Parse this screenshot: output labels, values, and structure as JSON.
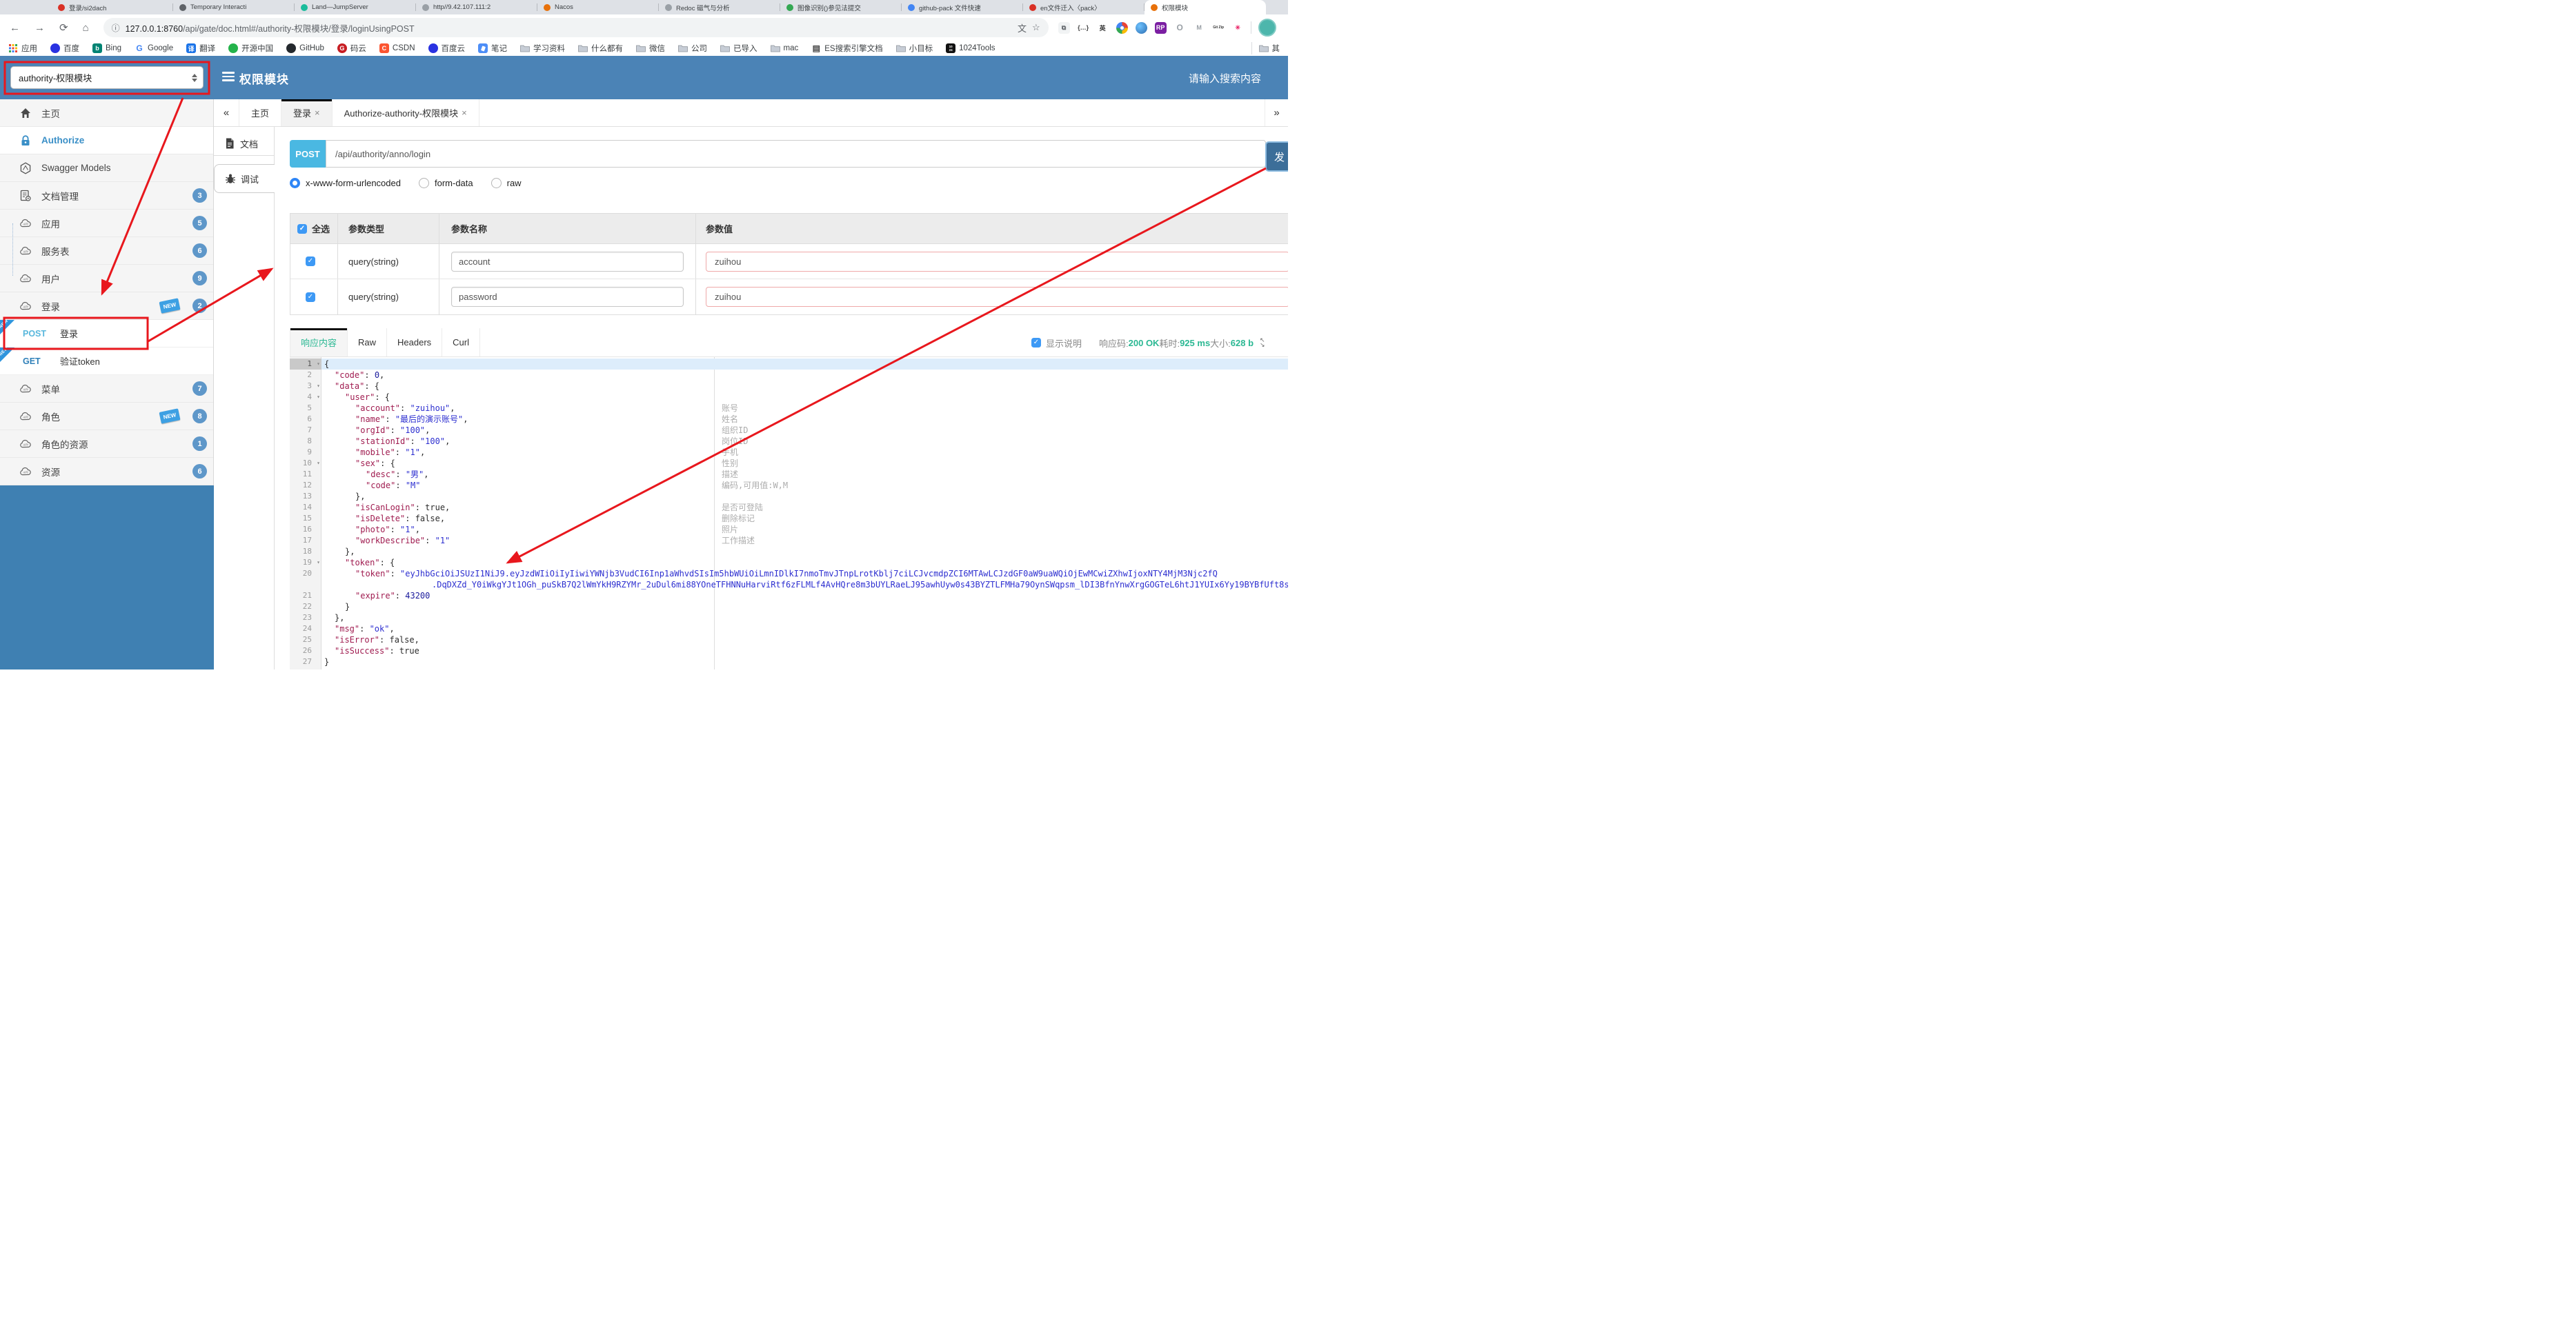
{
  "annotation_color": "#e8171d",
  "browser": {
    "tab_strip": [
      {
        "title": "登录/si2dach",
        "icon_color": "#d93025"
      },
      {
        "title": "Temporary Interacti",
        "icon_color": "#5f6368"
      },
      {
        "title": "Land—JumpServer",
        "icon_color": "#1abc9c"
      },
      {
        "title": "http//9.42.107.111:2",
        "icon_color": "#9aa0a6"
      },
      {
        "title": "Nacos",
        "icon_color": "#e8710a"
      },
      {
        "title": "Redoc 磁气与分析",
        "icon_color": "#9aa0a6"
      },
      {
        "title": "图像识别()参见法提交",
        "icon_color": "#34a853"
      },
      {
        "title": "github-pack 文件快速",
        "icon_color": "#4285f4"
      },
      {
        "title": "en文件迁入〈pack〉",
        "icon_color": "#d93025"
      },
      {
        "title": "权限模块",
        "icon_color": "#e8710a",
        "active": true
      }
    ],
    "toolbar": {
      "url_host": "127.0.0.1:8760",
      "url_path": "/api/gate/doc.html#/authority-权限模块/登录/loginUsingPOST",
      "info_icon": "ⓘ",
      "translate_icon": "文",
      "star_icon": "☆",
      "extensions": [
        {
          "name": "page-icon",
          "glyph": "⧉",
          "fg": "#5f6368",
          "bg": "#f1f3f4"
        },
        {
          "name": "braces-icon",
          "glyph": "{…}",
          "fg": "#444",
          "bg": "#fff"
        },
        {
          "name": "en-translate-icon",
          "glyph": "英",
          "fg": "#333",
          "bg": "#fff"
        },
        {
          "name": "chrome-icon",
          "glyph": "",
          "fg": "#fff",
          "bg": "conic"
        },
        {
          "name": "globe-icon",
          "glyph": "",
          "fg": "#fff",
          "bg": "#3a7bd5"
        },
        {
          "name": "rp-icon",
          "glyph": "RP",
          "fg": "#fff",
          "bg": "#7b1fa2"
        },
        {
          "name": "ring-icon",
          "glyph": "O",
          "fg": "#9aa0a6",
          "bg": "#fff"
        },
        {
          "name": "chevron-icon",
          "glyph": "M",
          "fg": "#9aa0a6",
          "bg": "#fff"
        },
        {
          "name": "gitzip-icon",
          "glyph": "Git Zip",
          "fg": "#333",
          "bg": "#fff"
        },
        {
          "name": "asterisk-icon",
          "glyph": "✳",
          "fg": "#e91e63",
          "bg": "#fff"
        }
      ]
    },
    "bookmarks": [
      {
        "label": "应用",
        "icon": "apps"
      },
      {
        "label": "百度",
        "icon": "baidu"
      },
      {
        "label": "Bing",
        "icon": "bing"
      },
      {
        "label": "Google",
        "icon": "google"
      },
      {
        "label": "翻译",
        "icon": "translate"
      },
      {
        "label": "开源中国",
        "icon": "oschina"
      },
      {
        "label": "GitHub",
        "icon": "github"
      },
      {
        "label": "码云",
        "icon": "gitee"
      },
      {
        "label": "CSDN",
        "icon": "csdn"
      },
      {
        "label": "百度云",
        "icon": "baiduyun"
      },
      {
        "label": "笔记",
        "icon": "note"
      },
      {
        "label": "学习资料",
        "icon": "folder"
      },
      {
        "label": "什么都有",
        "icon": "folder"
      },
      {
        "label": "微信",
        "icon": "folder"
      },
      {
        "label": "公司",
        "icon": "folder"
      },
      {
        "label": "已导入",
        "icon": "folder"
      },
      {
        "label": "mac",
        "icon": "folder"
      },
      {
        "label": "ES搜索引擎文档",
        "icon": "book"
      },
      {
        "label": "小目标",
        "icon": "folder"
      },
      {
        "label": "1024Tools",
        "icon": "tools1024"
      },
      {
        "label": "其",
        "icon": "folder"
      }
    ]
  },
  "header": {
    "module_select": "authority-权限模块",
    "title": "权限模块",
    "search_placeholder": "请输入搜索内容"
  },
  "sidebar": {
    "items": [
      {
        "label": "主页",
        "icon": "home-icon"
      },
      {
        "label": "Authorize",
        "icon": "lock-icon",
        "active": true
      },
      {
        "label": "Swagger Models",
        "icon": "models-icon"
      },
      {
        "label": "文档管理",
        "icon": "doc-manage-icon",
        "badge": "3"
      },
      {
        "label": "应用",
        "icon": "api-cloud-icon",
        "badge": "5"
      },
      {
        "label": "服务表",
        "icon": "api-cloud-icon",
        "badge": "6"
      },
      {
        "label": "用户",
        "icon": "api-cloud-icon",
        "badge": "9"
      },
      {
        "label": "登录",
        "icon": "api-cloud-icon",
        "badge": "2",
        "new": true
      },
      {
        "type": "sub",
        "method": "POST",
        "label": "登录",
        "method_color": "#58b7dc",
        "new_corner": true
      },
      {
        "type": "sub",
        "method": "GET",
        "label": "验证token",
        "method_color": "#2f80b9",
        "new_corner": true
      },
      {
        "label": "菜单",
        "icon": "api-cloud-icon",
        "badge": "7"
      },
      {
        "label": "角色",
        "icon": "api-cloud-icon",
        "badge": "8",
        "new": true
      },
      {
        "label": "角色的资源",
        "icon": "api-cloud-icon",
        "badge": "1"
      },
      {
        "label": "资源",
        "icon": "api-cloud-icon",
        "badge": "6"
      }
    ]
  },
  "workspace_tabs": {
    "collapse": "«",
    "expand": "»",
    "tabs": [
      {
        "label": "主页"
      },
      {
        "label": "登录",
        "close": "×",
        "active": true
      },
      {
        "label": "Authorize-authority-权限模块",
        "close": "×"
      }
    ]
  },
  "doc_nav": [
    {
      "label": "文档",
      "icon": "document-icon"
    },
    {
      "label": "调试",
      "icon": "debug-icon",
      "active": true
    }
  ],
  "request": {
    "method": "POST",
    "path": "/api/authority/anno/login",
    "send_label": "发",
    "content_types": [
      "x-www-form-urlencoded",
      "form-data",
      "raw"
    ],
    "selected_content_type": "x-www-form-urlencoded"
  },
  "params": {
    "headers": {
      "select_all": "全选",
      "type": "参数类型",
      "name": "参数名称",
      "value": "参数值"
    },
    "rows": [
      {
        "checked": true,
        "type": "query(string)",
        "name": "account",
        "value": "zuihou"
      },
      {
        "checked": true,
        "type": "query(string)",
        "name": "password",
        "value": "zuihou"
      }
    ]
  },
  "response": {
    "tabs": [
      "响应内容",
      "Raw",
      "Headers",
      "Curl"
    ],
    "active_tab": "响应内容",
    "show_desc_label": "显示说明",
    "show_desc_checked": true,
    "status": [
      {
        "label": "响应码:",
        "value": "200 OK"
      },
      {
        "label": "耗时:",
        "value": "925 ms"
      },
      {
        "label": "大小:",
        "value": "628 b"
      }
    ]
  },
  "code": {
    "lines": [
      {
        "n": 1,
        "ind": 0,
        "fold": true,
        "active": true,
        "parts": [
          [
            "pl",
            "{"
          ]
        ]
      },
      {
        "n": 2,
        "ind": 1,
        "parts": [
          [
            "k",
            "\"code\""
          ],
          [
            "pl",
            ": "
          ],
          [
            "num",
            "0"
          ],
          [
            "pl",
            ","
          ]
        ]
      },
      {
        "n": 3,
        "ind": 1,
        "fold": true,
        "parts": [
          [
            "k",
            "\"data\""
          ],
          [
            "pl",
            ": {"
          ]
        ]
      },
      {
        "n": 4,
        "ind": 2,
        "fold": true,
        "parts": [
          [
            "k",
            "\"user\""
          ],
          [
            "pl",
            ": {"
          ]
        ]
      },
      {
        "n": 5,
        "ind": 3,
        "ann": "账号",
        "parts": [
          [
            "k",
            "\"account\""
          ],
          [
            "pl",
            ": "
          ],
          [
            "s",
            "\"zuihou\""
          ],
          [
            "pl",
            ","
          ]
        ]
      },
      {
        "n": 6,
        "ind": 3,
        "ann": "姓名",
        "parts": [
          [
            "k",
            "\"name\""
          ],
          [
            "pl",
            ": "
          ],
          [
            "s",
            "\"最后的演示账号\""
          ],
          [
            "pl",
            ","
          ]
        ]
      },
      {
        "n": 7,
        "ind": 3,
        "ann": "组织ID",
        "parts": [
          [
            "k",
            "\"orgId\""
          ],
          [
            "pl",
            ": "
          ],
          [
            "s",
            "\"100\""
          ],
          [
            "pl",
            ","
          ]
        ]
      },
      {
        "n": 8,
        "ind": 3,
        "ann": "岗位ID",
        "parts": [
          [
            "k",
            "\"stationId\""
          ],
          [
            "pl",
            ": "
          ],
          [
            "s",
            "\"100\""
          ],
          [
            "pl",
            ","
          ]
        ]
      },
      {
        "n": 9,
        "ind": 3,
        "ann": "手机",
        "parts": [
          [
            "k",
            "\"mobile\""
          ],
          [
            "pl",
            ": "
          ],
          [
            "s",
            "\"1\""
          ],
          [
            "pl",
            ","
          ]
        ]
      },
      {
        "n": 10,
        "ind": 3,
        "fold": true,
        "ann": "性别",
        "parts": [
          [
            "k",
            "\"sex\""
          ],
          [
            "pl",
            ": {"
          ]
        ]
      },
      {
        "n": 11,
        "ind": 4,
        "ann": "描述",
        "parts": [
          [
            "k",
            "\"desc\""
          ],
          [
            "pl",
            ": "
          ],
          [
            "s",
            "\"男\""
          ],
          [
            "pl",
            ","
          ]
        ]
      },
      {
        "n": 12,
        "ind": 4,
        "ann": "编码,可用值:W,M",
        "parts": [
          [
            "k",
            "\"code\""
          ],
          [
            "pl",
            ": "
          ],
          [
            "s",
            "\"M\""
          ]
        ]
      },
      {
        "n": 13,
        "ind": 3,
        "parts": [
          [
            "pl",
            "},"
          ]
        ]
      },
      {
        "n": 14,
        "ind": 3,
        "ann": "是否可登陆",
        "parts": [
          [
            "k",
            "\"isCanLogin\""
          ],
          [
            "pl",
            ": true,"
          ]
        ]
      },
      {
        "n": 15,
        "ind": 3,
        "ann": "删除标记",
        "parts": [
          [
            "k",
            "\"isDelete\""
          ],
          [
            "pl",
            ": false,"
          ]
        ]
      },
      {
        "n": 16,
        "ind": 3,
        "ann": "照片",
        "parts": [
          [
            "k",
            "\"photo\""
          ],
          [
            "pl",
            ": "
          ],
          [
            "s",
            "\"1\""
          ],
          [
            "pl",
            ","
          ]
        ]
      },
      {
        "n": 17,
        "ind": 3,
        "ann": "工作描述",
        "parts": [
          [
            "k",
            "\"workDescribe\""
          ],
          [
            "pl",
            ": "
          ],
          [
            "s",
            "\"1\""
          ]
        ]
      },
      {
        "n": 18,
        "ind": 2,
        "parts": [
          [
            "pl",
            "},"
          ]
        ]
      },
      {
        "n": 19,
        "ind": 2,
        "fold": true,
        "parts": [
          [
            "k",
            "\"token\""
          ],
          [
            "pl",
            ": {"
          ]
        ]
      },
      {
        "n": 20,
        "ind": 3,
        "parts": [
          [
            "k",
            "\"token\""
          ],
          [
            "pl",
            ": "
          ],
          [
            "s",
            "\"eyJhbGciOiJSUzI1NiJ9.eyJzdWIiOiIyIiwiYWNjb3VudCI6Inp1aWhvdSIsIm5hbWUiOiLmnIDlkI7nmoTmvJTnpLrotKblj7ciLCJvcmdpZCI6MTAwLCJzdGF0aW9uaWQiOjEwMCwiZXhwIjoxNTY4MjM3Njc2fQ"
          ]
        ]
      },
      {
        "wrap": true,
        "parts": [
          [
            "s",
            ".DqDXZd_Y0iWkgYJt1OGh_puSkB7Q2lWmYkH9RZYMr_2uDul6mi88YOneTFHNNuHarviRtf6zFLMLf4AvHQre8m3bUYLRaeLJ95awhUyw0s43BYZTLFMHa79OynSWqpsm_lDI3BfnYnwXrgGOGTeL6htJ1YUIx6Yy19BYBfUft8s\","
          ]
        ]
      },
      {
        "n": 21,
        "ind": 3,
        "parts": [
          [
            "k",
            "\"expire\""
          ],
          [
            "pl",
            ": "
          ],
          [
            "num",
            "43200"
          ]
        ]
      },
      {
        "n": 22,
        "ind": 2,
        "parts": [
          [
            "pl",
            "}"
          ]
        ]
      },
      {
        "n": 23,
        "ind": 1,
        "parts": [
          [
            "pl",
            "},"
          ]
        ]
      },
      {
        "n": 24,
        "ind": 1,
        "parts": [
          [
            "k",
            "\"msg\""
          ],
          [
            "pl",
            ": "
          ],
          [
            "s",
            "\"ok\""
          ],
          [
            "pl",
            ","
          ]
        ]
      },
      {
        "n": 25,
        "ind": 1,
        "parts": [
          [
            "k",
            "\"isError\""
          ],
          [
            "pl",
            ": false,"
          ]
        ]
      },
      {
        "n": 26,
        "ind": 1,
        "parts": [
          [
            "k",
            "\"isSuccess\""
          ],
          [
            "pl",
            ": true"
          ]
        ]
      },
      {
        "n": 27,
        "ind": 0,
        "parts": [
          [
            "pl",
            "}"
          ]
        ]
      }
    ]
  }
}
